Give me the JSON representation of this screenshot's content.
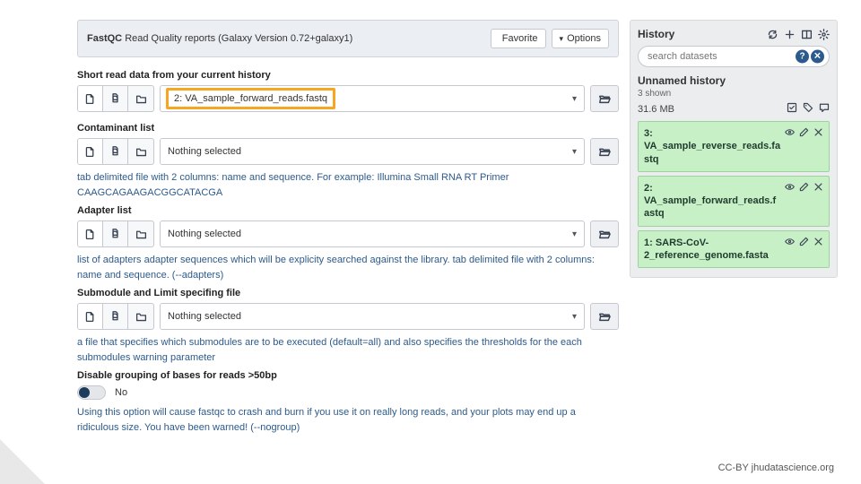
{
  "tool": {
    "name": "FastQC",
    "subtitle": "Read Quality reports (Galaxy Version 0.72+galaxy1)",
    "favorite_label": "Favorite",
    "options_label": "Options"
  },
  "fields": {
    "short_read": {
      "label": "Short read data from your current history",
      "value": "2: VA_sample_forward_reads.fastq"
    },
    "contaminant": {
      "label": "Contaminant list",
      "value": "Nothing selected",
      "help": "tab delimited file with 2 columns: name and sequence. For example: Illumina Small RNA RT Primer CAAGCAGAAGACGGCATACGA"
    },
    "adapter": {
      "label": "Adapter list",
      "value": "Nothing selected",
      "help": "list of adapters adapter sequences which will be explicity searched against the library. tab delimited file with 2 columns: name and sequence. (--adapters)"
    },
    "submodule": {
      "label": "Submodule and Limit specifing file",
      "value": "Nothing selected",
      "help": "a file that specifies which submodules are to be executed (default=all) and also specifies the thresholds for the each submodules warning parameter"
    },
    "nogroup": {
      "label": "Disable grouping of bases for reads >50bp",
      "value": "No",
      "help": "Using this option will cause fastqc to crash and burn if you use it on really long reads, and your plots may end up a ridiculous size. You have been warned! (--nogroup)"
    }
  },
  "history": {
    "panel_title": "History",
    "search_placeholder": "search datasets",
    "name": "Unnamed history",
    "shown": "3 shown",
    "size": "31.6 MB",
    "items": [
      {
        "label": "3: VA_sample_reverse_reads.fastq"
      },
      {
        "label": "2: VA_sample_forward_reads.fastq"
      },
      {
        "label": "1: SARS-CoV-2_reference_genome.fasta"
      }
    ]
  },
  "attribution": "CC-BY  jhudatascience.org"
}
